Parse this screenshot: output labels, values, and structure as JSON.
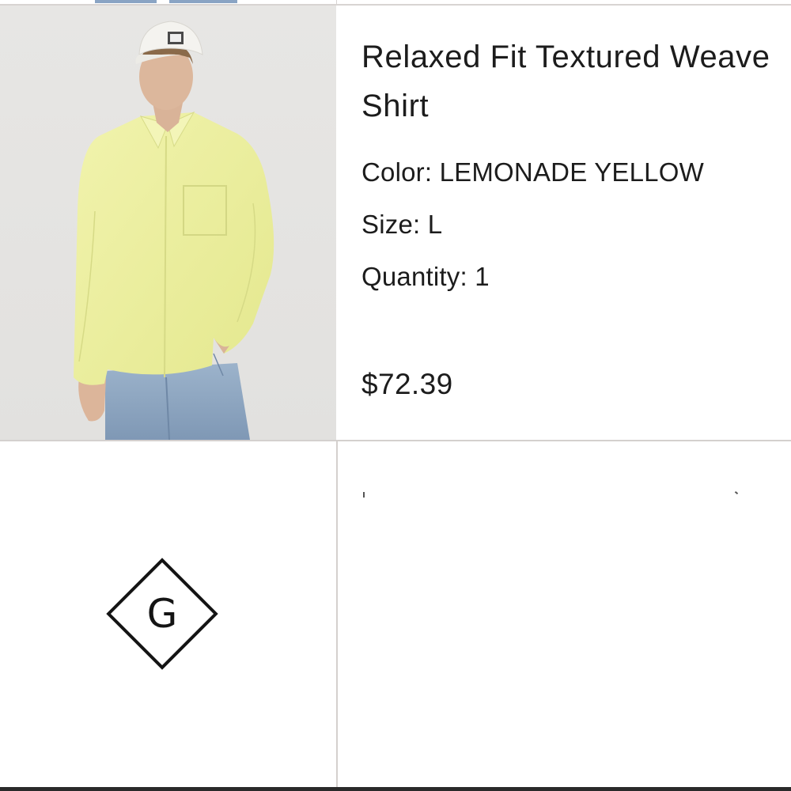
{
  "product": {
    "title": "Relaxed Fit Textured Weave Shirt",
    "color_label": "Color:",
    "color_value": "LEMONADE YELLOW",
    "size_label": "Size:",
    "size_value": "L",
    "quantity_label": "Quantity:",
    "quantity_value": "1",
    "price": "$72.39",
    "image": {
      "subject": "model wearing yellow shirt, white cap and light blue jeans",
      "shirt_color": "#eef0a0",
      "background_color": "#e5e4e2"
    }
  },
  "brand": {
    "logo_letter": "G",
    "logo_icon": "diamond-g-logo"
  },
  "colors": {
    "text": "#1c1c1c",
    "divider": "#d4d0ce"
  }
}
